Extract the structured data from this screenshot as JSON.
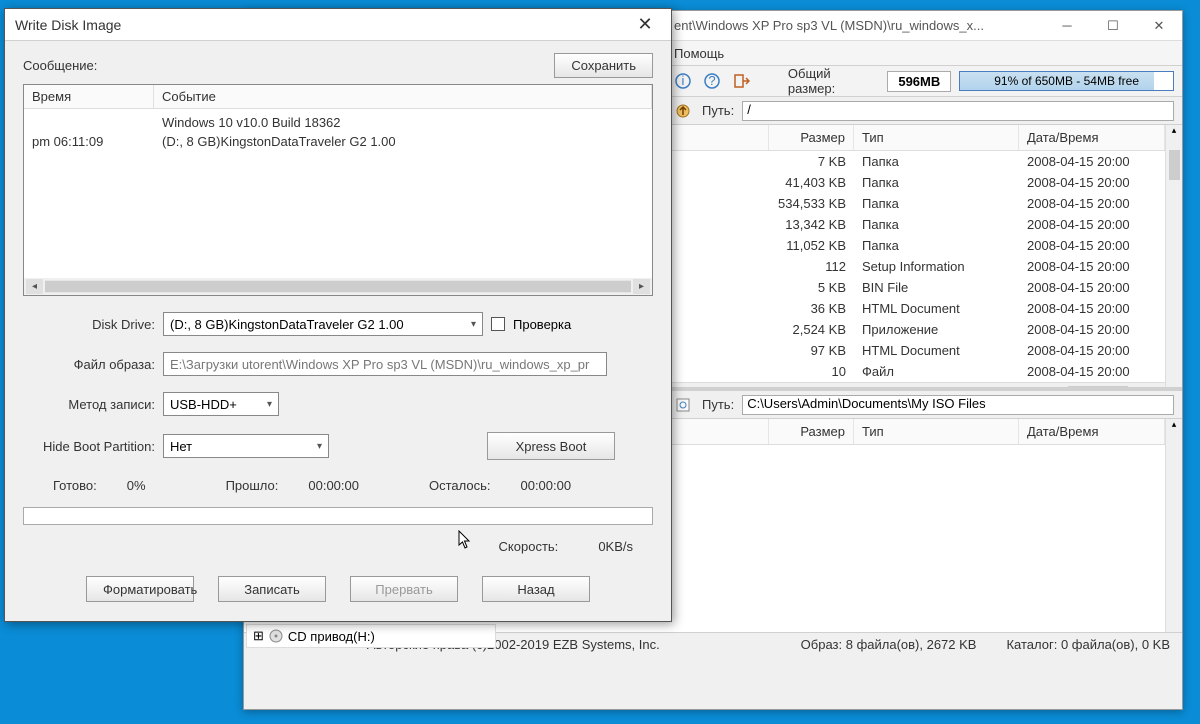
{
  "main_window": {
    "title_fragment": "ent\\Windows XP Pro sp3 VL (MSDN)\\ru_windows_x...",
    "menu": [
      "Помощь"
    ],
    "total_size_label": "Общий размер:",
    "total_size_value": "596MB",
    "capacity_text": "91% of 650MB - 54MB free",
    "path_label": "Путь:",
    "path_value": "/",
    "columns": {
      "size": "Размер",
      "type": "Тип",
      "date": "Дата/Время"
    },
    "files": [
      {
        "size": "7 KB",
        "type": "Папка",
        "date": "2008-04-15 20:00"
      },
      {
        "size": "41,403 KB",
        "type": "Папка",
        "date": "2008-04-15 20:00"
      },
      {
        "size": "534,533 KB",
        "type": "Папка",
        "date": "2008-04-15 20:00"
      },
      {
        "size": "13,342 KB",
        "type": "Папка",
        "date": "2008-04-15 20:00"
      },
      {
        "size": "11,052 KB",
        "type": "Папка",
        "date": "2008-04-15 20:00"
      },
      {
        "size": "112",
        "type": "Setup Information",
        "date": "2008-04-15 20:00"
      },
      {
        "size": "5 KB",
        "type": "BIN File",
        "date": "2008-04-15 20:00"
      },
      {
        "size": "36 KB",
        "type": "HTML Document",
        "date": "2008-04-15 20:00"
      },
      {
        "size": "2,524 KB",
        "type": "Приложение",
        "date": "2008-04-15 20:00"
      },
      {
        "size": "97 KB",
        "type": "HTML Document",
        "date": "2008-04-15 20:00"
      },
      {
        "size": "10",
        "type": "Файл",
        "date": "2008-04-15 20:00"
      }
    ],
    "bottom_path_label": "Путь:",
    "bottom_path_value": "C:\\Users\\Admin\\Documents\\My ISO Files",
    "status": {
      "copyright": "Авторские права (c)2002-2019 EZB Systems, Inc.",
      "image": "Образ: 8 файла(ов), 2672 KB",
      "catalog": "Каталог: 0 файла(ов), 0 KB"
    },
    "tree_item": "CD привод(H:)"
  },
  "dialog": {
    "title": "Write Disk Image",
    "message_label": "Сообщение:",
    "save_btn": "Сохранить",
    "log_columns": {
      "time": "Время",
      "event": "Событие"
    },
    "log_rows": [
      {
        "time": "",
        "event": "Windows 10 v10.0 Build 18362"
      },
      {
        "time": "pm 06:11:09",
        "event": "(D:, 8 GB)KingstonDataTraveler G2 1.00"
      }
    ],
    "disk_drive_label": "Disk Drive:",
    "disk_drive_value": "(D:, 8 GB)KingstonDataTraveler G2 1.00",
    "verify_label": "Проверка",
    "image_file_label": "Файл образа:",
    "image_file_value": "E:\\Загрузки utorent\\Windows XP Pro sp3 VL (MSDN)\\ru_windows_xp_pr",
    "write_method_label": "Метод записи:",
    "write_method_value": "USB-HDD+",
    "hide_boot_label": "Hide Boot Partition:",
    "hide_boot_value": "Нет",
    "xpress_boot_btn": "Xpress Boot",
    "ready_label": "Готово:",
    "ready_value": "0%",
    "elapsed_label": "Прошло:",
    "elapsed_value": "00:00:00",
    "remain_label": "Осталось:",
    "remain_value": "00:00:00",
    "speed_label": "Скорость:",
    "speed_value": "0KB/s",
    "btn_format": "Форматировать",
    "btn_write": "Записать",
    "btn_abort": "Прервать",
    "btn_back": "Назад"
  }
}
